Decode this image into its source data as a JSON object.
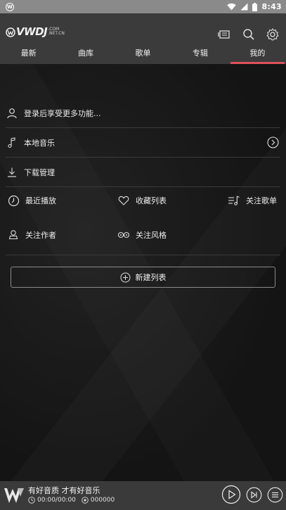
{
  "statusbar": {
    "time": "8:43",
    "app_icon": "W"
  },
  "header": {
    "logo_mark": "VWDJ",
    "logo_domain_top": ".COM",
    "logo_domain_bottom": ".NET.CN",
    "icons": [
      "queue-icon",
      "search-icon",
      "settings-icon"
    ]
  },
  "tabs": [
    {
      "label": "最新",
      "active": false
    },
    {
      "label": "曲库",
      "active": false
    },
    {
      "label": "歌单",
      "active": false
    },
    {
      "label": "专辑",
      "active": false
    },
    {
      "label": "我的",
      "active": true
    }
  ],
  "menu": {
    "login": "登录后享受更多功能...",
    "local_music": "本地音乐",
    "downloads": "下载管理"
  },
  "grid": {
    "recent": "最近播放",
    "favorites": "收藏列表",
    "followed_playlists": "关注歌单",
    "followed_artists": "关注作者",
    "followed_styles": "关注风格"
  },
  "new_list_label": "新建列表",
  "player": {
    "title": "有好音质 才有好音乐",
    "time": "00:00/00:00",
    "count": "000000"
  },
  "colors": {
    "accent": "#e0505a",
    "header": "#3b3b3b",
    "statusbar": "#8a8a8a"
  }
}
